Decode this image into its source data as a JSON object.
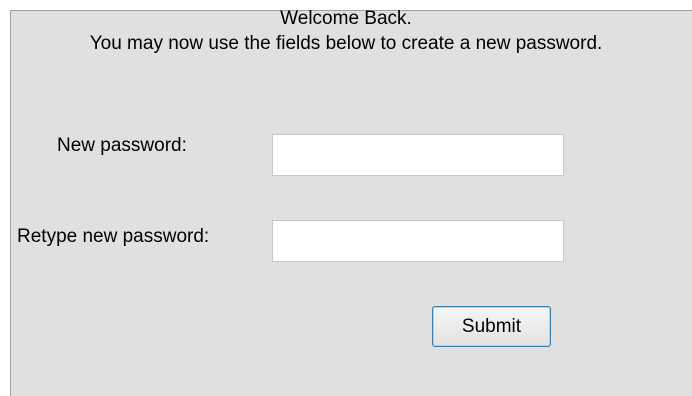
{
  "header": {
    "welcome": "Welcome Back.",
    "instructions": "You may now use the fields below to create a new password."
  },
  "form": {
    "new_password_label": "New password:",
    "new_password_value": "",
    "retype_password_label": "Retype new password:",
    "retype_password_value": "",
    "submit_label": "Submit"
  },
  "colors": {
    "panel_background": "#e0e0e0",
    "button_border": "#3c7fb1"
  }
}
